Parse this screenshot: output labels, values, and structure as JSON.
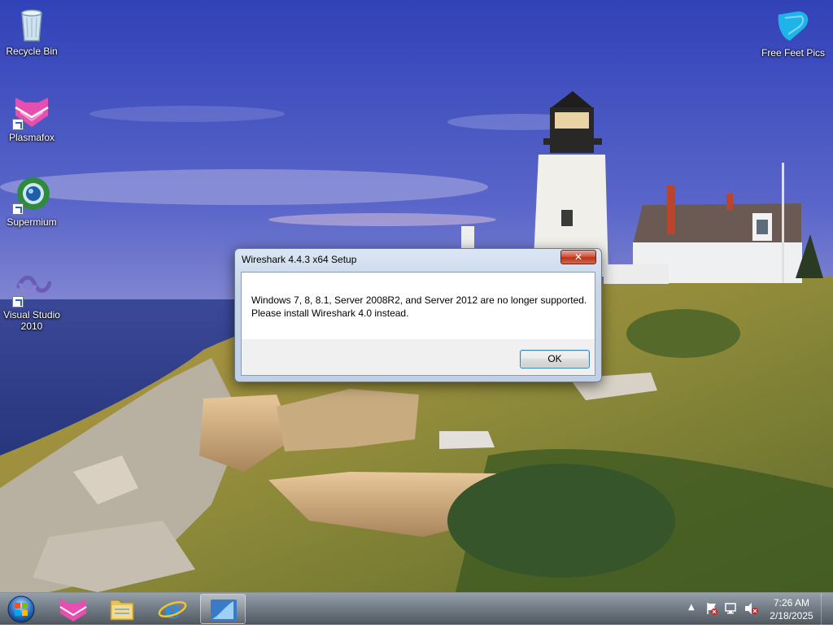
{
  "desktop": {
    "icons": [
      {
        "label": "Recycle Bin"
      },
      {
        "label": "Plasmafox"
      },
      {
        "label": "Supermium"
      },
      {
        "label": "Visual Studio 2010"
      },
      {
        "label": "Free Feet Pics"
      }
    ]
  },
  "dialog": {
    "title": "Wireshark 4.4.3 x64 Setup",
    "close_label": "✕",
    "message_line1": "Windows 7, 8, 8.1, Server 2008R2, and Server 2012 are no longer supported.",
    "message_line2": "Please install Wireshark 4.0 instead.",
    "ok_label": "OK"
  },
  "taskbar": {
    "items": [
      {
        "icon": "plasmafox-icon"
      },
      {
        "icon": "file-explorer-icon"
      },
      {
        "icon": "internet-explorer-icon"
      },
      {
        "icon": "wireshark-icon",
        "active": true
      }
    ],
    "tray": {
      "icons": [
        "show-hidden-icons-chevron",
        "action-center-flag-icon",
        "network-icon",
        "volume-muted-icon"
      ],
      "time": "7:26 AM",
      "date": "2/18/2025"
    }
  },
  "colors": {
    "sky_top": "#3b4fc4",
    "sea": "#34449a",
    "close_button": "#c9462c",
    "dialog_frame": "#c7d6ea"
  }
}
